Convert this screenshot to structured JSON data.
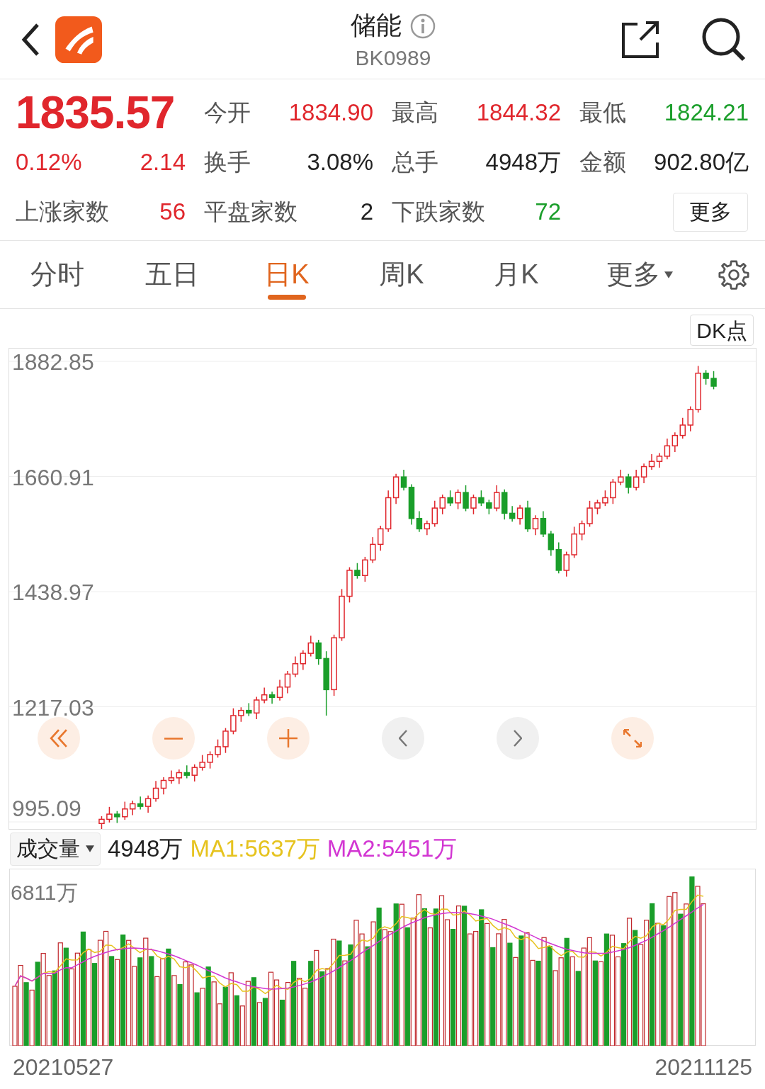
{
  "header": {
    "title": "储能",
    "code": "BK0989"
  },
  "quote": {
    "price": "1835.57",
    "change_pct": "0.12%",
    "change": "2.14",
    "color": "#e0262c",
    "stats": [
      {
        "label": "今开",
        "value": "1834.90",
        "color": "#e0262c"
      },
      {
        "label": "最高",
        "value": "1844.32",
        "color": "#e0262c"
      },
      {
        "label": "最低",
        "value": "1824.21",
        "color": "#1a9e2a"
      },
      {
        "label": "换手",
        "value": "3.08%",
        "color": "#222222"
      },
      {
        "label": "总手",
        "value": "4948万",
        "color": "#222222"
      },
      {
        "label": "金额",
        "value": "902.80亿",
        "color": "#222222"
      }
    ],
    "breadth": [
      {
        "label": "上涨家数",
        "value": "56",
        "color": "#e0262c"
      },
      {
        "label": "平盘家数",
        "value": "2",
        "color": "#222222"
      },
      {
        "label": "下跌家数",
        "value": "72",
        "color": "#1a9e2a"
      }
    ],
    "more_button": "更多"
  },
  "tabs": [
    {
      "label": "分时",
      "selected": false
    },
    {
      "label": "五日",
      "selected": false
    },
    {
      "label": "日K",
      "selected": true
    },
    {
      "label": "周K",
      "selected": false
    },
    {
      "label": "月K",
      "selected": false
    }
  ],
  "tabs_more": "更多",
  "dk_button": "DK点",
  "price_chart": {
    "chart_data": {
      "type": "candlestick",
      "grid": true,
      "ylim": [
        995.09,
        1882.85
      ],
      "yticks": [
        1882.85,
        1660.91,
        1438.97,
        1217.03,
        995.09
      ],
      "ohlc": [
        [
          992,
          1006,
          980,
          1000
        ],
        [
          1000,
          1024,
          994,
          1010
        ],
        [
          1010,
          1016,
          993,
          1005
        ],
        [
          1005,
          1034,
          999,
          1020
        ],
        [
          1020,
          1036,
          1008,
          1030
        ],
        [
          1030,
          1044,
          1019,
          1025
        ],
        [
          1025,
          1046,
          1013,
          1040
        ],
        [
          1040,
          1074,
          1034,
          1060
        ],
        [
          1060,
          1081,
          1048,
          1075
        ],
        [
          1075,
          1094,
          1069,
          1080
        ],
        [
          1080,
          1096,
          1068,
          1090
        ],
        [
          1090,
          1104,
          1079,
          1085
        ],
        [
          1085,
          1106,
          1073,
          1100
        ],
        [
          1100,
          1124,
          1094,
          1110
        ],
        [
          1110,
          1131,
          1098,
          1125
        ],
        [
          1125,
          1154,
          1119,
          1140
        ],
        [
          1140,
          1176,
          1128,
          1170
        ],
        [
          1170,
          1214,
          1164,
          1200
        ],
        [
          1200,
          1216,
          1188,
          1210
        ],
        [
          1210,
          1224,
          1199,
          1205
        ],
        [
          1205,
          1236,
          1193,
          1230
        ],
        [
          1230,
          1254,
          1224,
          1240
        ],
        [
          1240,
          1246,
          1223,
          1235
        ],
        [
          1235,
          1269,
          1229,
          1255
        ],
        [
          1255,
          1286,
          1243,
          1280
        ],
        [
          1280,
          1314,
          1274,
          1300
        ],
        [
          1300,
          1326,
          1288,
          1320
        ],
        [
          1320,
          1354,
          1314,
          1340
        ],
        [
          1340,
          1346,
          1298,
          1310
        ],
        [
          1310,
          1324,
          1200,
          1250
        ],
        [
          1250,
          1356,
          1238,
          1350
        ],
        [
          1350,
          1444,
          1344,
          1430
        ],
        [
          1430,
          1486,
          1418,
          1480
        ],
        [
          1480,
          1494,
          1464,
          1470
        ],
        [
          1470,
          1506,
          1458,
          1500
        ],
        [
          1500,
          1544,
          1494,
          1530
        ],
        [
          1530,
          1566,
          1518,
          1560
        ],
        [
          1560,
          1634,
          1554,
          1620
        ],
        [
          1620,
          1666,
          1608,
          1660
        ],
        [
          1660,
          1674,
          1634,
          1640
        ],
        [
          1640,
          1646,
          1568,
          1580
        ],
        [
          1580,
          1594,
          1554,
          1560
        ],
        [
          1560,
          1576,
          1548,
          1570
        ],
        [
          1570,
          1614,
          1564,
          1600
        ],
        [
          1600,
          1626,
          1588,
          1620
        ],
        [
          1620,
          1634,
          1604,
          1610
        ],
        [
          1610,
          1636,
          1598,
          1630
        ],
        [
          1630,
          1644,
          1594,
          1600
        ],
        [
          1600,
          1626,
          1588,
          1620
        ],
        [
          1620,
          1634,
          1604,
          1610
        ],
        [
          1610,
          1616,
          1588,
          1600
        ],
        [
          1600,
          1644,
          1594,
          1630
        ],
        [
          1630,
          1636,
          1578,
          1590
        ],
        [
          1590,
          1604,
          1574,
          1580
        ],
        [
          1580,
          1606,
          1568,
          1600
        ],
        [
          1600,
          1614,
          1554,
          1560
        ],
        [
          1560,
          1586,
          1548,
          1580
        ],
        [
          1580,
          1594,
          1544,
          1550
        ],
        [
          1550,
          1556,
          1508,
          1520
        ],
        [
          1520,
          1534,
          1474,
          1480
        ],
        [
          1480,
          1516,
          1468,
          1510
        ],
        [
          1510,
          1564,
          1504,
          1550
        ],
        [
          1550,
          1576,
          1538,
          1570
        ],
        [
          1570,
          1614,
          1564,
          1600
        ],
        [
          1600,
          1616,
          1588,
          1610
        ],
        [
          1610,
          1634,
          1604,
          1620
        ],
        [
          1620,
          1656,
          1608,
          1650
        ],
        [
          1650,
          1674,
          1644,
          1660
        ],
        [
          1660,
          1666,
          1628,
          1640
        ],
        [
          1640,
          1674,
          1634,
          1660
        ],
        [
          1660,
          1686,
          1648,
          1680
        ],
        [
          1680,
          1704,
          1674,
          1690
        ],
        [
          1690,
          1706,
          1678,
          1700
        ],
        [
          1700,
          1734,
          1694,
          1720
        ],
        [
          1720,
          1746,
          1708,
          1740
        ],
        [
          1740,
          1774,
          1734,
          1760
        ],
        [
          1760,
          1796,
          1748,
          1790
        ],
        [
          1790,
          1874,
          1784,
          1860
        ],
        [
          1860,
          1866,
          1838,
          1850
        ],
        [
          1850,
          1864,
          1829,
          1835
        ]
      ]
    }
  },
  "volume": {
    "selector": "成交量",
    "value": "4948万",
    "ma": [
      {
        "label": "MA1:5637万",
        "color": "#e6c31e"
      },
      {
        "label": "MA2:5451万",
        "color": "#d236d2"
      }
    ],
    "max_label": "6811万"
  },
  "dates": [
    "20210527",
    "20211125"
  ]
}
